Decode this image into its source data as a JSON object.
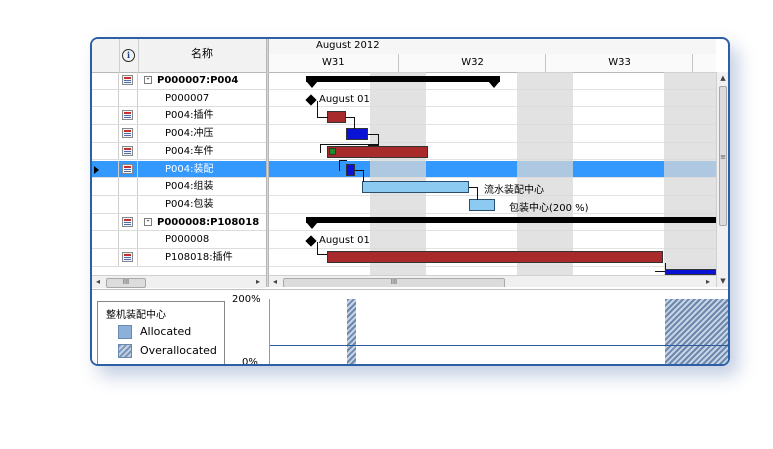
{
  "grid": {
    "header_name": "名称",
    "info_icon_text": "i",
    "rows": [
      {
        "name": "P000007:P004",
        "type": "summary",
        "icon": "task-icon",
        "expander": "-"
      },
      {
        "name": "P000007",
        "type": "milestone",
        "icon": ""
      },
      {
        "name": "P004:插件",
        "type": "task",
        "icon": "task-icon"
      },
      {
        "name": "P004:冲压",
        "type": "task",
        "icon": "task-icon"
      },
      {
        "name": "P004:车件",
        "type": "task",
        "icon": "task-icon"
      },
      {
        "name": "P004:装配",
        "type": "task",
        "icon": "task-icon",
        "selected": true
      },
      {
        "name": "P004:组装",
        "type": "task",
        "icon": ""
      },
      {
        "name": "P004:包装",
        "type": "task",
        "icon": ""
      },
      {
        "name": "P000008:P108018",
        "type": "summary",
        "icon": "task-icon",
        "expander": "-"
      },
      {
        "name": "P000008",
        "type": "milestone",
        "icon": ""
      },
      {
        "name": "P108018:插件",
        "type": "task",
        "icon": "task-icon"
      }
    ],
    "scroll_thumb_label": "III"
  },
  "gantt": {
    "month_label": "August 2012",
    "weeks": [
      "W31",
      "W32",
      "W33"
    ],
    "labels": {
      "milestone_1": "August 01",
      "milestone_2": "August 01",
      "assembly_line": "流水装配中心",
      "packing_center": "包装中心(200 %)"
    },
    "scroll_thumb_label": "III",
    "vscroll_thumb_label": "≡"
  },
  "histogram": {
    "legend_title": "整机装配中心",
    "legend_items": [
      {
        "label": "Allocated",
        "swatch": "alloc"
      },
      {
        "label": "Overallocated",
        "swatch": "over"
      }
    ],
    "axis_top": "200%",
    "axis_bottom": "0%"
  },
  "colors": {
    "selection": "#3399ff",
    "task_red": "#a82a2a",
    "task_blue": "#0a12d6",
    "task_light": "#8ccaf2",
    "frame_border": "#2c5fa3"
  }
}
